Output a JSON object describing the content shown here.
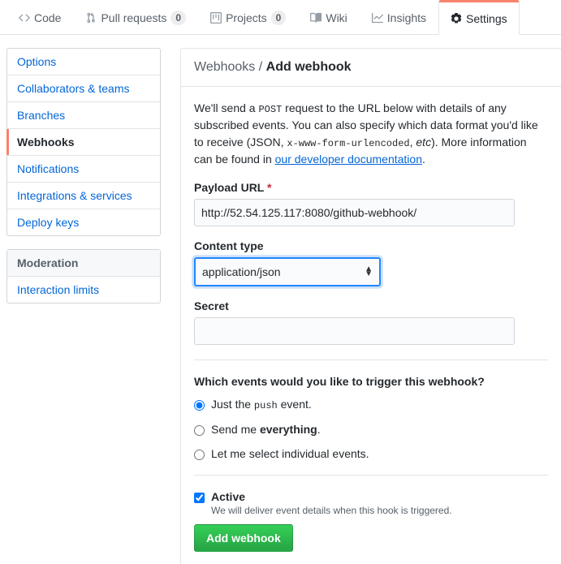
{
  "topTabs": {
    "code": "Code",
    "pullRequests": "Pull requests",
    "pullRequestsCount": "0",
    "projects": "Projects",
    "projectsCount": "0",
    "wiki": "Wiki",
    "insights": "Insights",
    "settings": "Settings"
  },
  "sidebar": {
    "items": {
      "options": "Options",
      "collaborators": "Collaborators & teams",
      "branches": "Branches",
      "webhooks": "Webhooks",
      "notifications": "Notifications",
      "integrations": "Integrations & services",
      "deploykeys": "Deploy keys"
    },
    "moderationHeader": "Moderation",
    "moderation": {
      "interactionLimits": "Interaction limits"
    }
  },
  "breadcrumb": {
    "parent": "Webhooks",
    "sep": " / ",
    "current": "Add webhook"
  },
  "description": {
    "p1a": "We'll send a ",
    "p1code1": "POST",
    "p1b": " request to the URL below with details of any subscribed events. You can also specify which data format you'd like to receive (JSON, ",
    "p1code2": "x-www-form-urlencoded",
    "p1c": ", ",
    "p1em": "etc",
    "p1d": "). More information can be found in ",
    "docLink": "our developer documentation",
    "p1e": "."
  },
  "form": {
    "payloadLabel": "Payload URL",
    "payloadValue": "http://52.54.125.117:8080/github-webhook/",
    "contentTypeLabel": "Content type",
    "contentTypeValue": "application/json",
    "secretLabel": "Secret",
    "secretValue": "",
    "eventsTitle": "Which events would you like to trigger this webhook?",
    "radio1a": "Just the ",
    "radio1code": "push",
    "radio1b": " event.",
    "radio2a": "Send me ",
    "radio2b": "everything",
    "radio2c": ".",
    "radio3": "Let me select individual events.",
    "activeLabel": "Active",
    "activeDesc": "We will deliver event details when this hook is triggered.",
    "submit": "Add webhook"
  }
}
